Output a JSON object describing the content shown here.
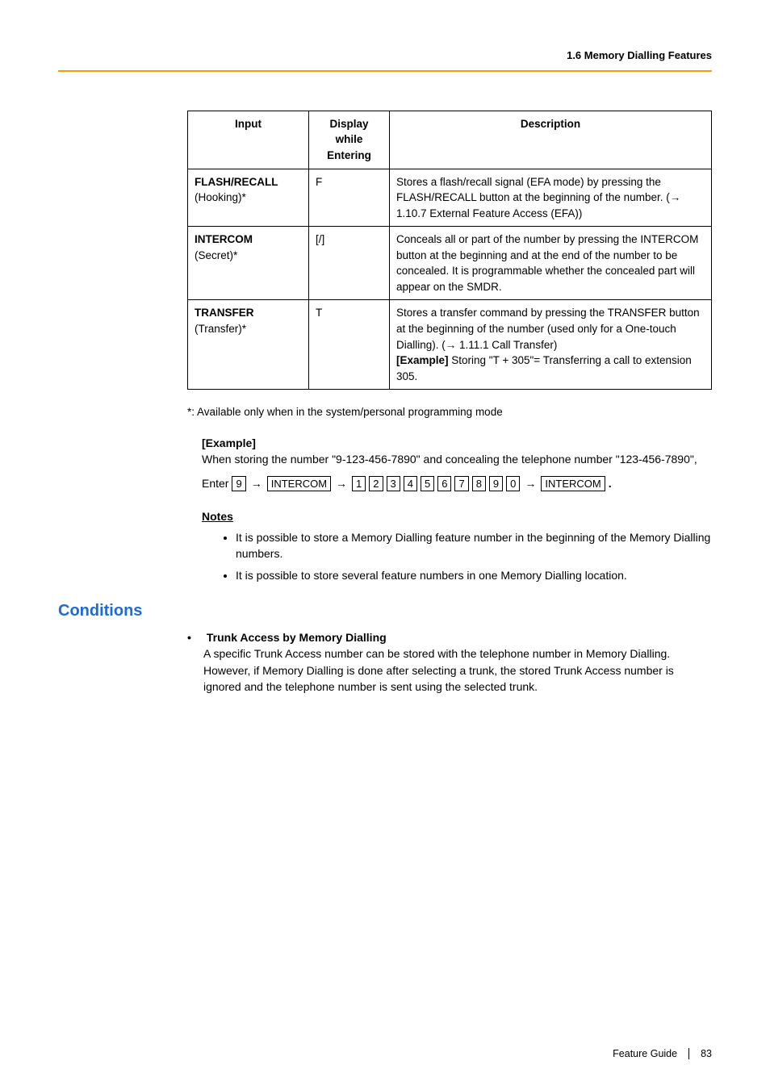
{
  "header": {
    "section": "1.6 Memory Dialling Features"
  },
  "table": {
    "headers": {
      "input": "Input",
      "display": "Display while Entering",
      "description": "Description"
    },
    "rows": [
      {
        "input_strong": "FLASH/RECALL",
        "input_rest": "(Hooking)*",
        "display": "F",
        "description": "Stores a flash/recall signal (EFA mode) by pressing the FLASH/RECALL button at the beginning of the number. (→ 1.10.7 External Feature Access (EFA))"
      },
      {
        "input_strong": "INTERCOM",
        "input_rest": "(Secret)*",
        "display": "[/]",
        "description": "Conceals all or part of the number by pressing the INTERCOM button at the beginning and at the end of the number to be concealed. It is programmable whether the concealed part will appear on the SMDR."
      },
      {
        "input_strong": "TRANSFER",
        "input_rest": "(Transfer)*",
        "display": "T",
        "description_pre": "Stores a transfer command by pressing the TRANSFER button at the beginning of the number (used only for a One-touch Dialling). (→ 1.11.1 Call Transfer)",
        "description_example_label": "[Example]",
        "description_example_text": " Storing \"T + 305\"= Transferring a call to extension 305."
      }
    ]
  },
  "asterisk_note": "*:   Available only when in the system/personal programming mode",
  "example": {
    "label": "[Example]",
    "text": "When storing the number \"9-123-456-7890\" and concealing the telephone number \"123-456-7890\","
  },
  "enter": {
    "prefix": "Enter",
    "keys_first": "9",
    "intercom": "INTERCOM",
    "digits": [
      "1",
      "2",
      "3",
      "4",
      "5",
      "6",
      "7",
      "8",
      "9",
      "0"
    ],
    "period": "."
  },
  "notes": {
    "heading": "Notes",
    "items": [
      "It is possible to store a Memory Dialling feature number in the beginning of the Memory Dialling numbers.",
      "It is possible to store several feature numbers in one Memory Dialling location."
    ]
  },
  "conditions": {
    "heading": "Conditions",
    "items": [
      {
        "title": "Trunk Access by Memory Dialling",
        "body": "A specific Trunk Access number can be stored with the telephone number in Memory Dialling. However, if Memory Dialling is done after selecting a trunk, the stored Trunk Access number is ignored and the telephone number is sent using the selected trunk."
      }
    ]
  },
  "footer": {
    "label": "Feature Guide",
    "page": "83"
  }
}
